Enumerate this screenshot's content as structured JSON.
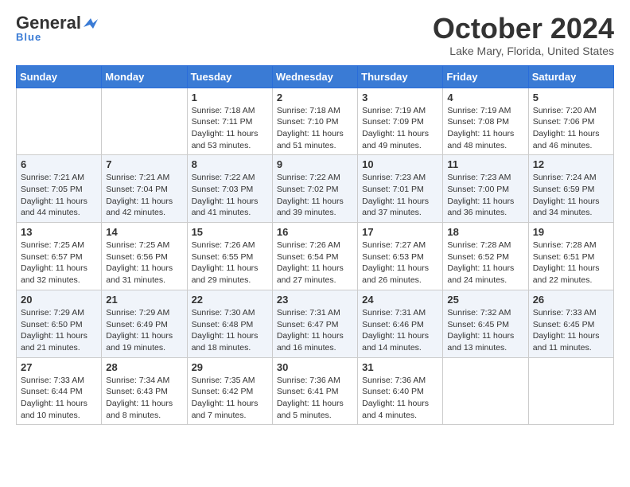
{
  "header": {
    "logo_general": "General",
    "logo_blue": "Blue",
    "month_title": "October 2024",
    "location": "Lake Mary, Florida, United States"
  },
  "days_of_week": [
    "Sunday",
    "Monday",
    "Tuesday",
    "Wednesday",
    "Thursday",
    "Friday",
    "Saturday"
  ],
  "weeks": [
    [
      {
        "day": "",
        "info": ""
      },
      {
        "day": "",
        "info": ""
      },
      {
        "day": "1",
        "info": "Sunrise: 7:18 AM\nSunset: 7:11 PM\nDaylight: 11 hours and 53 minutes."
      },
      {
        "day": "2",
        "info": "Sunrise: 7:18 AM\nSunset: 7:10 PM\nDaylight: 11 hours and 51 minutes."
      },
      {
        "day": "3",
        "info": "Sunrise: 7:19 AM\nSunset: 7:09 PM\nDaylight: 11 hours and 49 minutes."
      },
      {
        "day": "4",
        "info": "Sunrise: 7:19 AM\nSunset: 7:08 PM\nDaylight: 11 hours and 48 minutes."
      },
      {
        "day": "5",
        "info": "Sunrise: 7:20 AM\nSunset: 7:06 PM\nDaylight: 11 hours and 46 minutes."
      }
    ],
    [
      {
        "day": "6",
        "info": "Sunrise: 7:21 AM\nSunset: 7:05 PM\nDaylight: 11 hours and 44 minutes."
      },
      {
        "day": "7",
        "info": "Sunrise: 7:21 AM\nSunset: 7:04 PM\nDaylight: 11 hours and 42 minutes."
      },
      {
        "day": "8",
        "info": "Sunrise: 7:22 AM\nSunset: 7:03 PM\nDaylight: 11 hours and 41 minutes."
      },
      {
        "day": "9",
        "info": "Sunrise: 7:22 AM\nSunset: 7:02 PM\nDaylight: 11 hours and 39 minutes."
      },
      {
        "day": "10",
        "info": "Sunrise: 7:23 AM\nSunset: 7:01 PM\nDaylight: 11 hours and 37 minutes."
      },
      {
        "day": "11",
        "info": "Sunrise: 7:23 AM\nSunset: 7:00 PM\nDaylight: 11 hours and 36 minutes."
      },
      {
        "day": "12",
        "info": "Sunrise: 7:24 AM\nSunset: 6:59 PM\nDaylight: 11 hours and 34 minutes."
      }
    ],
    [
      {
        "day": "13",
        "info": "Sunrise: 7:25 AM\nSunset: 6:57 PM\nDaylight: 11 hours and 32 minutes."
      },
      {
        "day": "14",
        "info": "Sunrise: 7:25 AM\nSunset: 6:56 PM\nDaylight: 11 hours and 31 minutes."
      },
      {
        "day": "15",
        "info": "Sunrise: 7:26 AM\nSunset: 6:55 PM\nDaylight: 11 hours and 29 minutes."
      },
      {
        "day": "16",
        "info": "Sunrise: 7:26 AM\nSunset: 6:54 PM\nDaylight: 11 hours and 27 minutes."
      },
      {
        "day": "17",
        "info": "Sunrise: 7:27 AM\nSunset: 6:53 PM\nDaylight: 11 hours and 26 minutes."
      },
      {
        "day": "18",
        "info": "Sunrise: 7:28 AM\nSunset: 6:52 PM\nDaylight: 11 hours and 24 minutes."
      },
      {
        "day": "19",
        "info": "Sunrise: 7:28 AM\nSunset: 6:51 PM\nDaylight: 11 hours and 22 minutes."
      }
    ],
    [
      {
        "day": "20",
        "info": "Sunrise: 7:29 AM\nSunset: 6:50 PM\nDaylight: 11 hours and 21 minutes."
      },
      {
        "day": "21",
        "info": "Sunrise: 7:29 AM\nSunset: 6:49 PM\nDaylight: 11 hours and 19 minutes."
      },
      {
        "day": "22",
        "info": "Sunrise: 7:30 AM\nSunset: 6:48 PM\nDaylight: 11 hours and 18 minutes."
      },
      {
        "day": "23",
        "info": "Sunrise: 7:31 AM\nSunset: 6:47 PM\nDaylight: 11 hours and 16 minutes."
      },
      {
        "day": "24",
        "info": "Sunrise: 7:31 AM\nSunset: 6:46 PM\nDaylight: 11 hours and 14 minutes."
      },
      {
        "day": "25",
        "info": "Sunrise: 7:32 AM\nSunset: 6:45 PM\nDaylight: 11 hours and 13 minutes."
      },
      {
        "day": "26",
        "info": "Sunrise: 7:33 AM\nSunset: 6:45 PM\nDaylight: 11 hours and 11 minutes."
      }
    ],
    [
      {
        "day": "27",
        "info": "Sunrise: 7:33 AM\nSunset: 6:44 PM\nDaylight: 11 hours and 10 minutes."
      },
      {
        "day": "28",
        "info": "Sunrise: 7:34 AM\nSunset: 6:43 PM\nDaylight: 11 hours and 8 minutes."
      },
      {
        "day": "29",
        "info": "Sunrise: 7:35 AM\nSunset: 6:42 PM\nDaylight: 11 hours and 7 minutes."
      },
      {
        "day": "30",
        "info": "Sunrise: 7:36 AM\nSunset: 6:41 PM\nDaylight: 11 hours and 5 minutes."
      },
      {
        "day": "31",
        "info": "Sunrise: 7:36 AM\nSunset: 6:40 PM\nDaylight: 11 hours and 4 minutes."
      },
      {
        "day": "",
        "info": ""
      },
      {
        "day": "",
        "info": ""
      }
    ]
  ]
}
